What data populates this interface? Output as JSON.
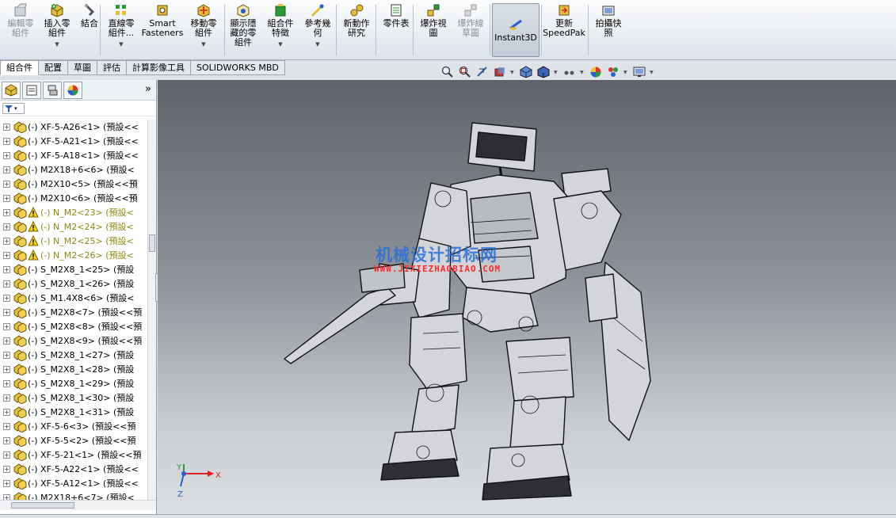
{
  "ribbon": {
    "buttons": [
      {
        "id": "edit-component",
        "label": "編輯零\n組件",
        "disabled": true,
        "caret": false
      },
      {
        "id": "insert-component",
        "label": "插入零\n組件",
        "disabled": false,
        "caret": true
      },
      {
        "id": "mate",
        "label": "結合",
        "disabled": false,
        "caret": false
      },
      {
        "id": "linear-pattern",
        "label": "直線零\n組件...",
        "disabled": false,
        "caret": true
      },
      {
        "id": "smart-fasteners",
        "label": "Smart\nFasteners",
        "disabled": false,
        "caret": false
      },
      {
        "id": "move-component",
        "label": "移動零\n組件",
        "disabled": false,
        "caret": true
      },
      {
        "id": "show-hidden",
        "label": "顯示隱\n藏的零\n組件",
        "disabled": false,
        "caret": false
      },
      {
        "id": "assembly-features",
        "label": "組合件\n特徵",
        "disabled": false,
        "caret": true
      },
      {
        "id": "reference-geometry",
        "label": "參考幾\n何",
        "disabled": false,
        "caret": true
      },
      {
        "id": "new-motion-study",
        "label": "新動作\n研究",
        "disabled": false,
        "caret": false
      },
      {
        "id": "bom",
        "label": "零件表",
        "disabled": false,
        "caret": false
      },
      {
        "id": "exploded-view",
        "label": "爆炸視\n圖",
        "disabled": false,
        "caret": false
      },
      {
        "id": "explode-line-sketch",
        "label": "爆炸線\n草圖",
        "disabled": true,
        "caret": false
      },
      {
        "id": "instant3d",
        "label": "Instant3D",
        "disabled": false,
        "caret": false
      },
      {
        "id": "update-speedpak",
        "label": "更新\nSpeedPak",
        "disabled": false,
        "caret": false
      },
      {
        "id": "take-snapshot",
        "label": "拍攝快\n照",
        "disabled": false,
        "caret": false
      }
    ]
  },
  "command_tabs": [
    "組合件",
    "配置",
    "草圖",
    "評估",
    "計算影像工具",
    "SOLIDWORKS MBD"
  ],
  "panel": {
    "expand_symbol": "»",
    "filter_symbol": "▾"
  },
  "tree": [
    {
      "label": "(-) XF-5-A26<1> (預設<<",
      "warn": false
    },
    {
      "label": "(-) XF-5-A21<1> (預設<<",
      "warn": false
    },
    {
      "label": "(-) XF-5-A18<1> (預設<<",
      "warn": false
    },
    {
      "label": "(-) M2X18+6<6> (預設<",
      "warn": false
    },
    {
      "label": "(-) M2X10<5> (預設<<預",
      "warn": false
    },
    {
      "label": "(-) M2X10<6> (預設<<預",
      "warn": false
    },
    {
      "label": "(-) N_M2<23> (預設<",
      "warn": true
    },
    {
      "label": "(-) N_M2<24> (預設<",
      "warn": true
    },
    {
      "label": "(-) N_M2<25> (預設<",
      "warn": true
    },
    {
      "label": "(-) N_M2<26> (預設<",
      "warn": true
    },
    {
      "label": "(-) S_M2X8_1<25> (預設",
      "warn": false
    },
    {
      "label": "(-) S_M2X8_1<26> (預設",
      "warn": false
    },
    {
      "label": "(-) S_M1.4X8<6> (預設<",
      "warn": false
    },
    {
      "label": "(-) S_M2X8<7> (預設<<預",
      "warn": false
    },
    {
      "label": "(-) S_M2X8<8> (預設<<預",
      "warn": false
    },
    {
      "label": "(-) S_M2X8<9> (預設<<預",
      "warn": false
    },
    {
      "label": "(-) S_M2X8_1<27> (預設",
      "warn": false
    },
    {
      "label": "(-) S_M2X8_1<28> (預設",
      "warn": false
    },
    {
      "label": "(-) S_M2X8_1<29> (預設",
      "warn": false
    },
    {
      "label": "(-) S_M2X8_1<30> (預設",
      "warn": false
    },
    {
      "label": "(-) S_M2X8_1<31> (預設",
      "warn": false
    },
    {
      "label": "(-) XF-5-6<3> (預設<<預",
      "warn": false
    },
    {
      "label": "(-) XF-5-5<2> (預設<<預",
      "warn": false
    },
    {
      "label": "(-) XF-5-21<1> (預設<<預",
      "warn": false
    },
    {
      "label": "(-) XF-5-A22<1> (預設<<",
      "warn": false
    },
    {
      "label": "(-) XF-5-A12<1> (預設<<",
      "warn": false
    },
    {
      "label": "(-) M2X18+6<7> (預設<",
      "warn": false
    }
  ],
  "viewport": {
    "watermark": "机械设计招标网",
    "watermark_url": "WWW.JIXIEZHAOBIAO.COM",
    "triad": {
      "x": "X",
      "y": "Y",
      "z": "Z"
    }
  },
  "colors": {
    "accent": "#2a6fd8",
    "warning": "#8c8a10",
    "watermark_url": "#ff2a2a"
  }
}
